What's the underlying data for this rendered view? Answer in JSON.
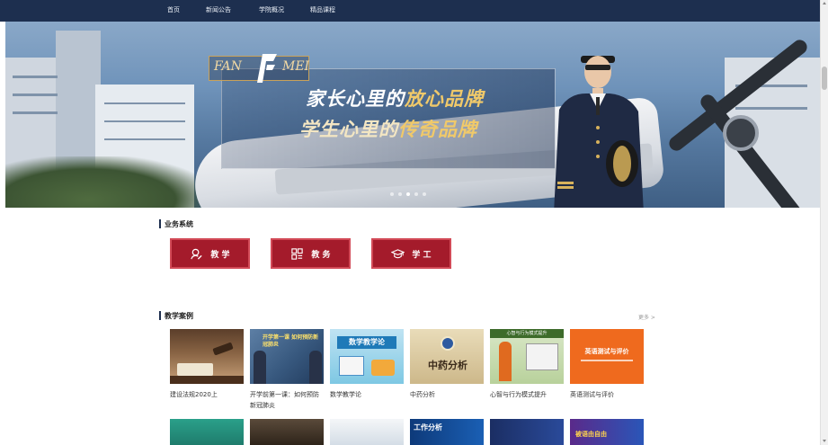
{
  "nav": {
    "items": [
      "首页",
      "新闻公告",
      "学院概况",
      "精品课程"
    ]
  },
  "banner": {
    "logo_left": "FAN",
    "logo_right": "MEI",
    "slogan_line1_a": "家长心里的",
    "slogan_line1_b": "放心品牌",
    "slogan_line2_a": "学生心里的",
    "slogan_line2_b": "传奇品牌"
  },
  "business": {
    "title": "业务系统",
    "buttons": [
      {
        "label": "教 学",
        "icon": "user-edit-icon"
      },
      {
        "label": "教 务",
        "icon": "grid-list-icon"
      },
      {
        "label": "学 工",
        "icon": "graduation-cap-icon"
      }
    ]
  },
  "cases": {
    "title": "教学案例",
    "more": "更多 >",
    "items": [
      {
        "caption": "建设法规2020上"
      },
      {
        "caption": "开学前第一课：如何预防新冠肺炎",
        "thumb_text": "开学第一课 如何预防新冠肺炎"
      },
      {
        "caption": "数学教学论",
        "thumb_text": "数学教学论"
      },
      {
        "caption": "中药分析",
        "thumb_text": "中药分析"
      },
      {
        "caption": "心智与行为模式提升",
        "thumb_text": "心智与行为模式提升"
      },
      {
        "caption": "英语测试与评价",
        "thumb_text": "英语测试与评价"
      }
    ],
    "row2_texts": [
      "工作分析",
      "被语由自由"
    ]
  },
  "colors": {
    "nav_bg": "#1d2f4f",
    "accent_red": "#a41b2b",
    "gold": "#f0c96a"
  }
}
